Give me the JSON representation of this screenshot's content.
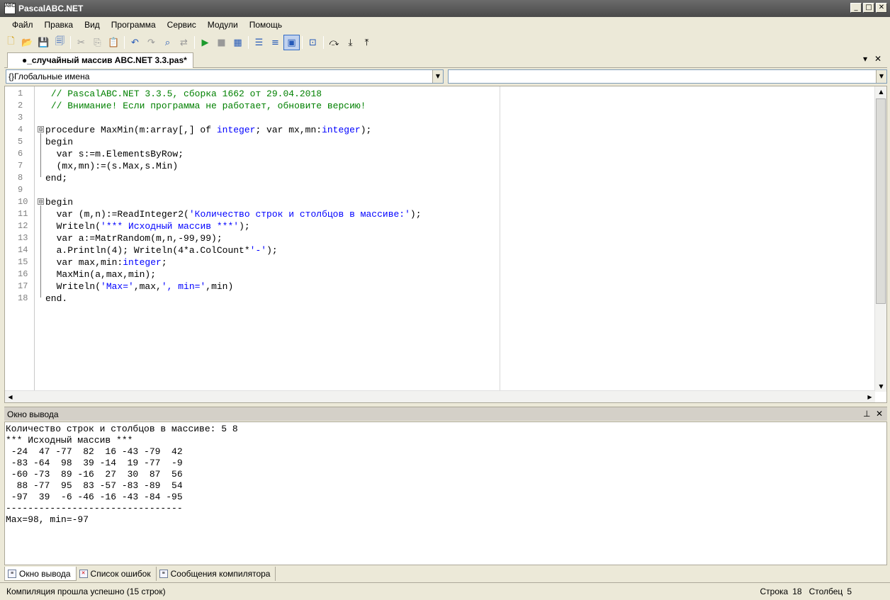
{
  "window": {
    "title": "PascalABC.NET",
    "icon_text": "ABC",
    "controls": [
      "_",
      "□",
      "✕"
    ]
  },
  "menu": [
    "Файл",
    "Правка",
    "Вид",
    "Программа",
    "Сервис",
    "Модули",
    "Помощь"
  ],
  "toolbar": {
    "buttons": [
      "new-file-icon",
      "open-folder-icon",
      "save-icon",
      "save-all-icon",
      "cut-icon",
      "copy-icon",
      "paste-icon",
      "undo-icon",
      "redo-icon",
      "find-icon",
      "replace-icon",
      "run-icon",
      "stop-icon",
      "debug-icon",
      "comment-icon",
      "uncomment-icon",
      "console-icon",
      "format-icon",
      "step-over-icon",
      "step-into-icon",
      "step-out-icon"
    ]
  },
  "document_tab": {
    "label": "●_случайный массив ABC.NET 3.3.pas*"
  },
  "combos": {
    "left": "{}Глобальные имена",
    "right": ""
  },
  "editor": {
    "line_numbers": [
      "1",
      "2",
      "3",
      "4",
      "5",
      "6",
      "7",
      "8",
      "9",
      "10",
      "11",
      "12",
      "13",
      "14",
      "15",
      "16",
      "17",
      "18"
    ],
    "lines": [
      {
        "parts": [
          {
            "t": "// PascalABC.NET 3.3.5, сборка 1662 от 29.04.2018",
            "c": "com"
          }
        ],
        "indent": 1
      },
      {
        "parts": [
          {
            "t": "// Внимание! Если программа не работает, обновите версию!",
            "c": "com"
          }
        ],
        "indent": 1
      },
      {
        "parts": [],
        "indent": 0
      },
      {
        "parts": [
          {
            "t": "procedure MaxMin(m:array[,] of ",
            "c": "kw"
          },
          {
            "t": "integer",
            "c": "typ"
          },
          {
            "t": "; var mx,mn:",
            "c": "kw"
          },
          {
            "t": "integer",
            "c": "typ"
          },
          {
            "t": ");",
            "c": "kw"
          }
        ],
        "indent": 0
      },
      {
        "parts": [
          {
            "t": "begin",
            "c": "kw"
          }
        ],
        "indent": 0
      },
      {
        "parts": [
          {
            "t": "  var s:=m.ElementsByRow;",
            "c": "kw"
          }
        ],
        "indent": 0
      },
      {
        "parts": [
          {
            "t": "  (mx,mn):=(s.Max,s.Min)",
            "c": "kw"
          }
        ],
        "indent": 0
      },
      {
        "parts": [
          {
            "t": "end;",
            "c": "kw"
          }
        ],
        "indent": 0
      },
      {
        "parts": [],
        "indent": 0
      },
      {
        "parts": [
          {
            "t": "begin",
            "c": "kw"
          }
        ],
        "indent": 0
      },
      {
        "parts": [
          {
            "t": "  var (m,n):=ReadInteger2(",
            "c": "kw"
          },
          {
            "t": "'Количество строк и столбцов в массиве:'",
            "c": "str"
          },
          {
            "t": ");",
            "c": "kw"
          }
        ],
        "indent": 0
      },
      {
        "parts": [
          {
            "t": "  Writeln(",
            "c": "kw"
          },
          {
            "t": "'*** Исходный массив ***'",
            "c": "str"
          },
          {
            "t": ");",
            "c": "kw"
          }
        ],
        "indent": 0
      },
      {
        "parts": [
          {
            "t": "  var a:=MatrRandom(m,n,-99,99);",
            "c": "kw"
          }
        ],
        "indent": 0
      },
      {
        "parts": [
          {
            "t": "  a.Println(4); Writeln(4*a.ColCount*",
            "c": "kw"
          },
          {
            "t": "'-'",
            "c": "str"
          },
          {
            "t": ");",
            "c": "kw"
          }
        ],
        "indent": 0
      },
      {
        "parts": [
          {
            "t": "  var max,min:",
            "c": "kw"
          },
          {
            "t": "integer",
            "c": "typ"
          },
          {
            "t": ";",
            "c": "kw"
          }
        ],
        "indent": 0
      },
      {
        "parts": [
          {
            "t": "  MaxMin(a,max,min);",
            "c": "kw"
          }
        ],
        "indent": 0
      },
      {
        "parts": [
          {
            "t": "  Writeln(",
            "c": "kw"
          },
          {
            "t": "'Max='",
            "c": "str"
          },
          {
            "t": ",max,",
            "c": "kw"
          },
          {
            "t": "', min='",
            "c": "str"
          },
          {
            "t": ",min)",
            "c": "kw"
          }
        ],
        "indent": 0
      },
      {
        "parts": [
          {
            "t": "end.",
            "c": "kw"
          }
        ],
        "indent": 0
      }
    ],
    "fold_markers": [
      "⊟",
      "⊟"
    ]
  },
  "output_panel": {
    "title": "Окно вывода",
    "pin": "📌",
    "close": "✕",
    "lines": [
      "Количество строк и столбцов в массиве: 5 8",
      "*** Исходный массив ***",
      " -24  47 -77  82  16 -43 -79  42",
      " -83 -64  98  39 -14  19 -77  -9",
      " -60 -73  89 -16  27  30  87  56",
      "  88 -77  95  83 -57 -83 -89  54",
      " -97  39  -6 -46 -16 -43 -84 -95",
      "--------------------------------",
      "Max=98, min=-97"
    ]
  },
  "bottom_tabs": [
    {
      "label": "Окно вывода",
      "icon": "output-window-icon"
    },
    {
      "label": "Список ошибок",
      "icon": "error-list-icon"
    },
    {
      "label": "Сообщения компилятора",
      "icon": "compiler-messages-icon"
    }
  ],
  "status": {
    "message": "Компиляция прошла успешно (15 строк)",
    "row_label": "Строка",
    "row_value": "18",
    "col_label": "Столбец",
    "col_value": "5"
  }
}
